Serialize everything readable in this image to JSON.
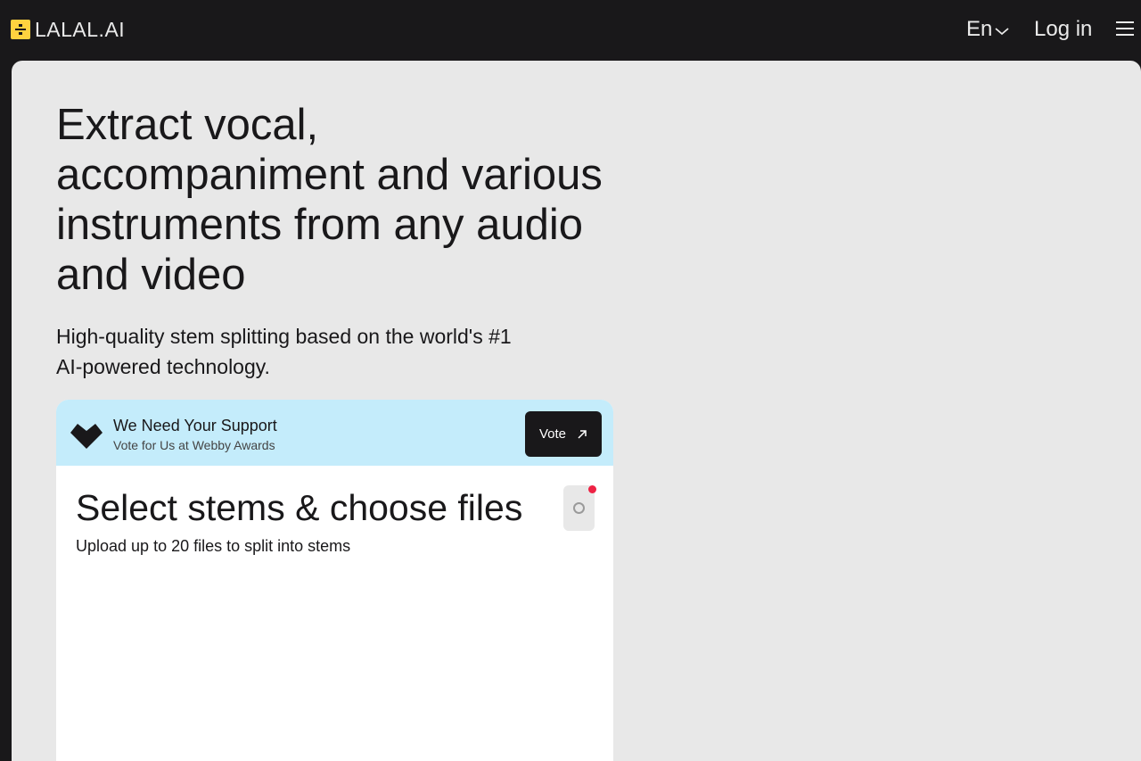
{
  "header": {
    "logo_text": "LALAL.AI",
    "brand_color": "#ffd23f",
    "language_label": "En",
    "login_label": "Log in"
  },
  "hero": {
    "title": "Extract vocal, accompaniment and various instruments from any audio and video",
    "subtitle": "High-quality stem splitting based on the world's #1 AI-powered technology."
  },
  "support_banner": {
    "title": "We Need Your Support",
    "subtitle": "Vote for Us at Webby Awards",
    "vote_label": "Vote",
    "background_color": "#c4ecfb"
  },
  "upload_panel": {
    "title": "Select stems & choose files",
    "subtitle": "Upload up to 20 files to split into stems",
    "notification_color": "#ee2244"
  },
  "icons": {
    "logo": "lalal-logo-icon",
    "language": "chevron-down-icon",
    "menu": "hamburger-menu-icon",
    "support": "heart-icon",
    "vote": "arrow-up-right-icon",
    "settings": "settings-icon"
  }
}
